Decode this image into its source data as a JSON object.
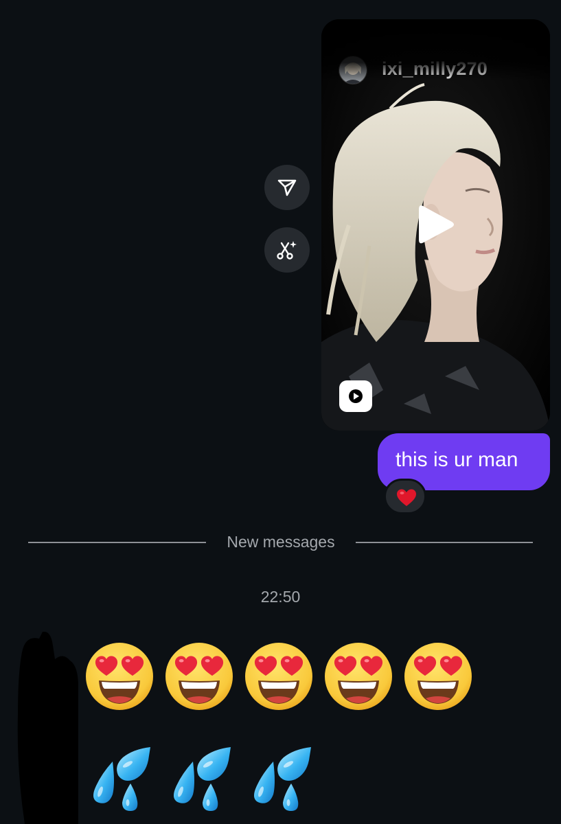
{
  "reel": {
    "username": "ixi_milly270",
    "icons": {
      "avatar": "profile-avatar",
      "play": "play-icon",
      "badge": "reels-icon"
    }
  },
  "actions": {
    "share_icon": "share-icon",
    "remix_icon": "remix-scissors-icon"
  },
  "message": {
    "text": "this is ur man",
    "reaction": "heart-reaction",
    "bubble_color": "#6f3cf2"
  },
  "divider": {
    "label": "New messages"
  },
  "timestamp": "22:50",
  "incoming": {
    "row1": [
      "heart-eyes-emoji",
      "heart-eyes-emoji",
      "heart-eyes-emoji",
      "heart-eyes-emoji",
      "heart-eyes-emoji"
    ],
    "row2": [
      "sweat-droplets-emoji",
      "sweat-droplets-emoji",
      "sweat-droplets-emoji"
    ]
  },
  "colors": {
    "background": "#0c1014",
    "button_bg": "#262a2f",
    "muted_text": "#a4a8ad"
  }
}
